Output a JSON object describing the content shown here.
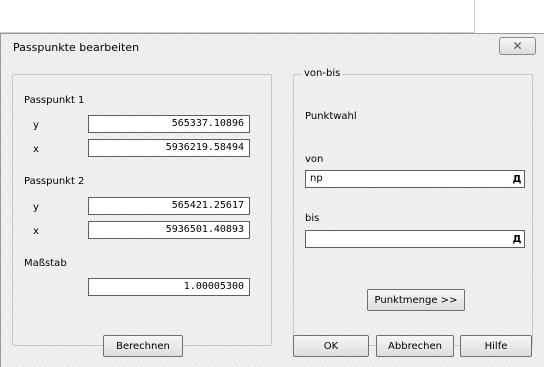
{
  "window": {
    "title": "Passpunkte bearbeiten",
    "close_glyph": "✕"
  },
  "passpunkt1": {
    "heading": "Passpunkt 1",
    "y_label": "y",
    "y_value": "565337.10896",
    "x_label": "x",
    "x_value": "5936219.58494"
  },
  "passpunkt2": {
    "heading": "Passpunkt 2",
    "y_label": "y",
    "y_value": "565421.25617",
    "x_label": "x",
    "x_value": "5936501.40893"
  },
  "massstab": {
    "label": "Maßstab",
    "value": "1.00005300"
  },
  "vonbis": {
    "legend": "von-bis",
    "punktwahl_label": "Punktwahl",
    "von_label": "von",
    "von_value": "np",
    "bis_label": "bis",
    "bis_value": "",
    "combo_icon": "dropdown-arrow-icon",
    "combo_glyph": "Д",
    "punktmenge_button": "Punktmenge >>"
  },
  "buttons": {
    "berechnen": "Berechnen",
    "ok": "OK",
    "abbrechen": "Abbrechen",
    "hilfe": "Hilfe"
  }
}
